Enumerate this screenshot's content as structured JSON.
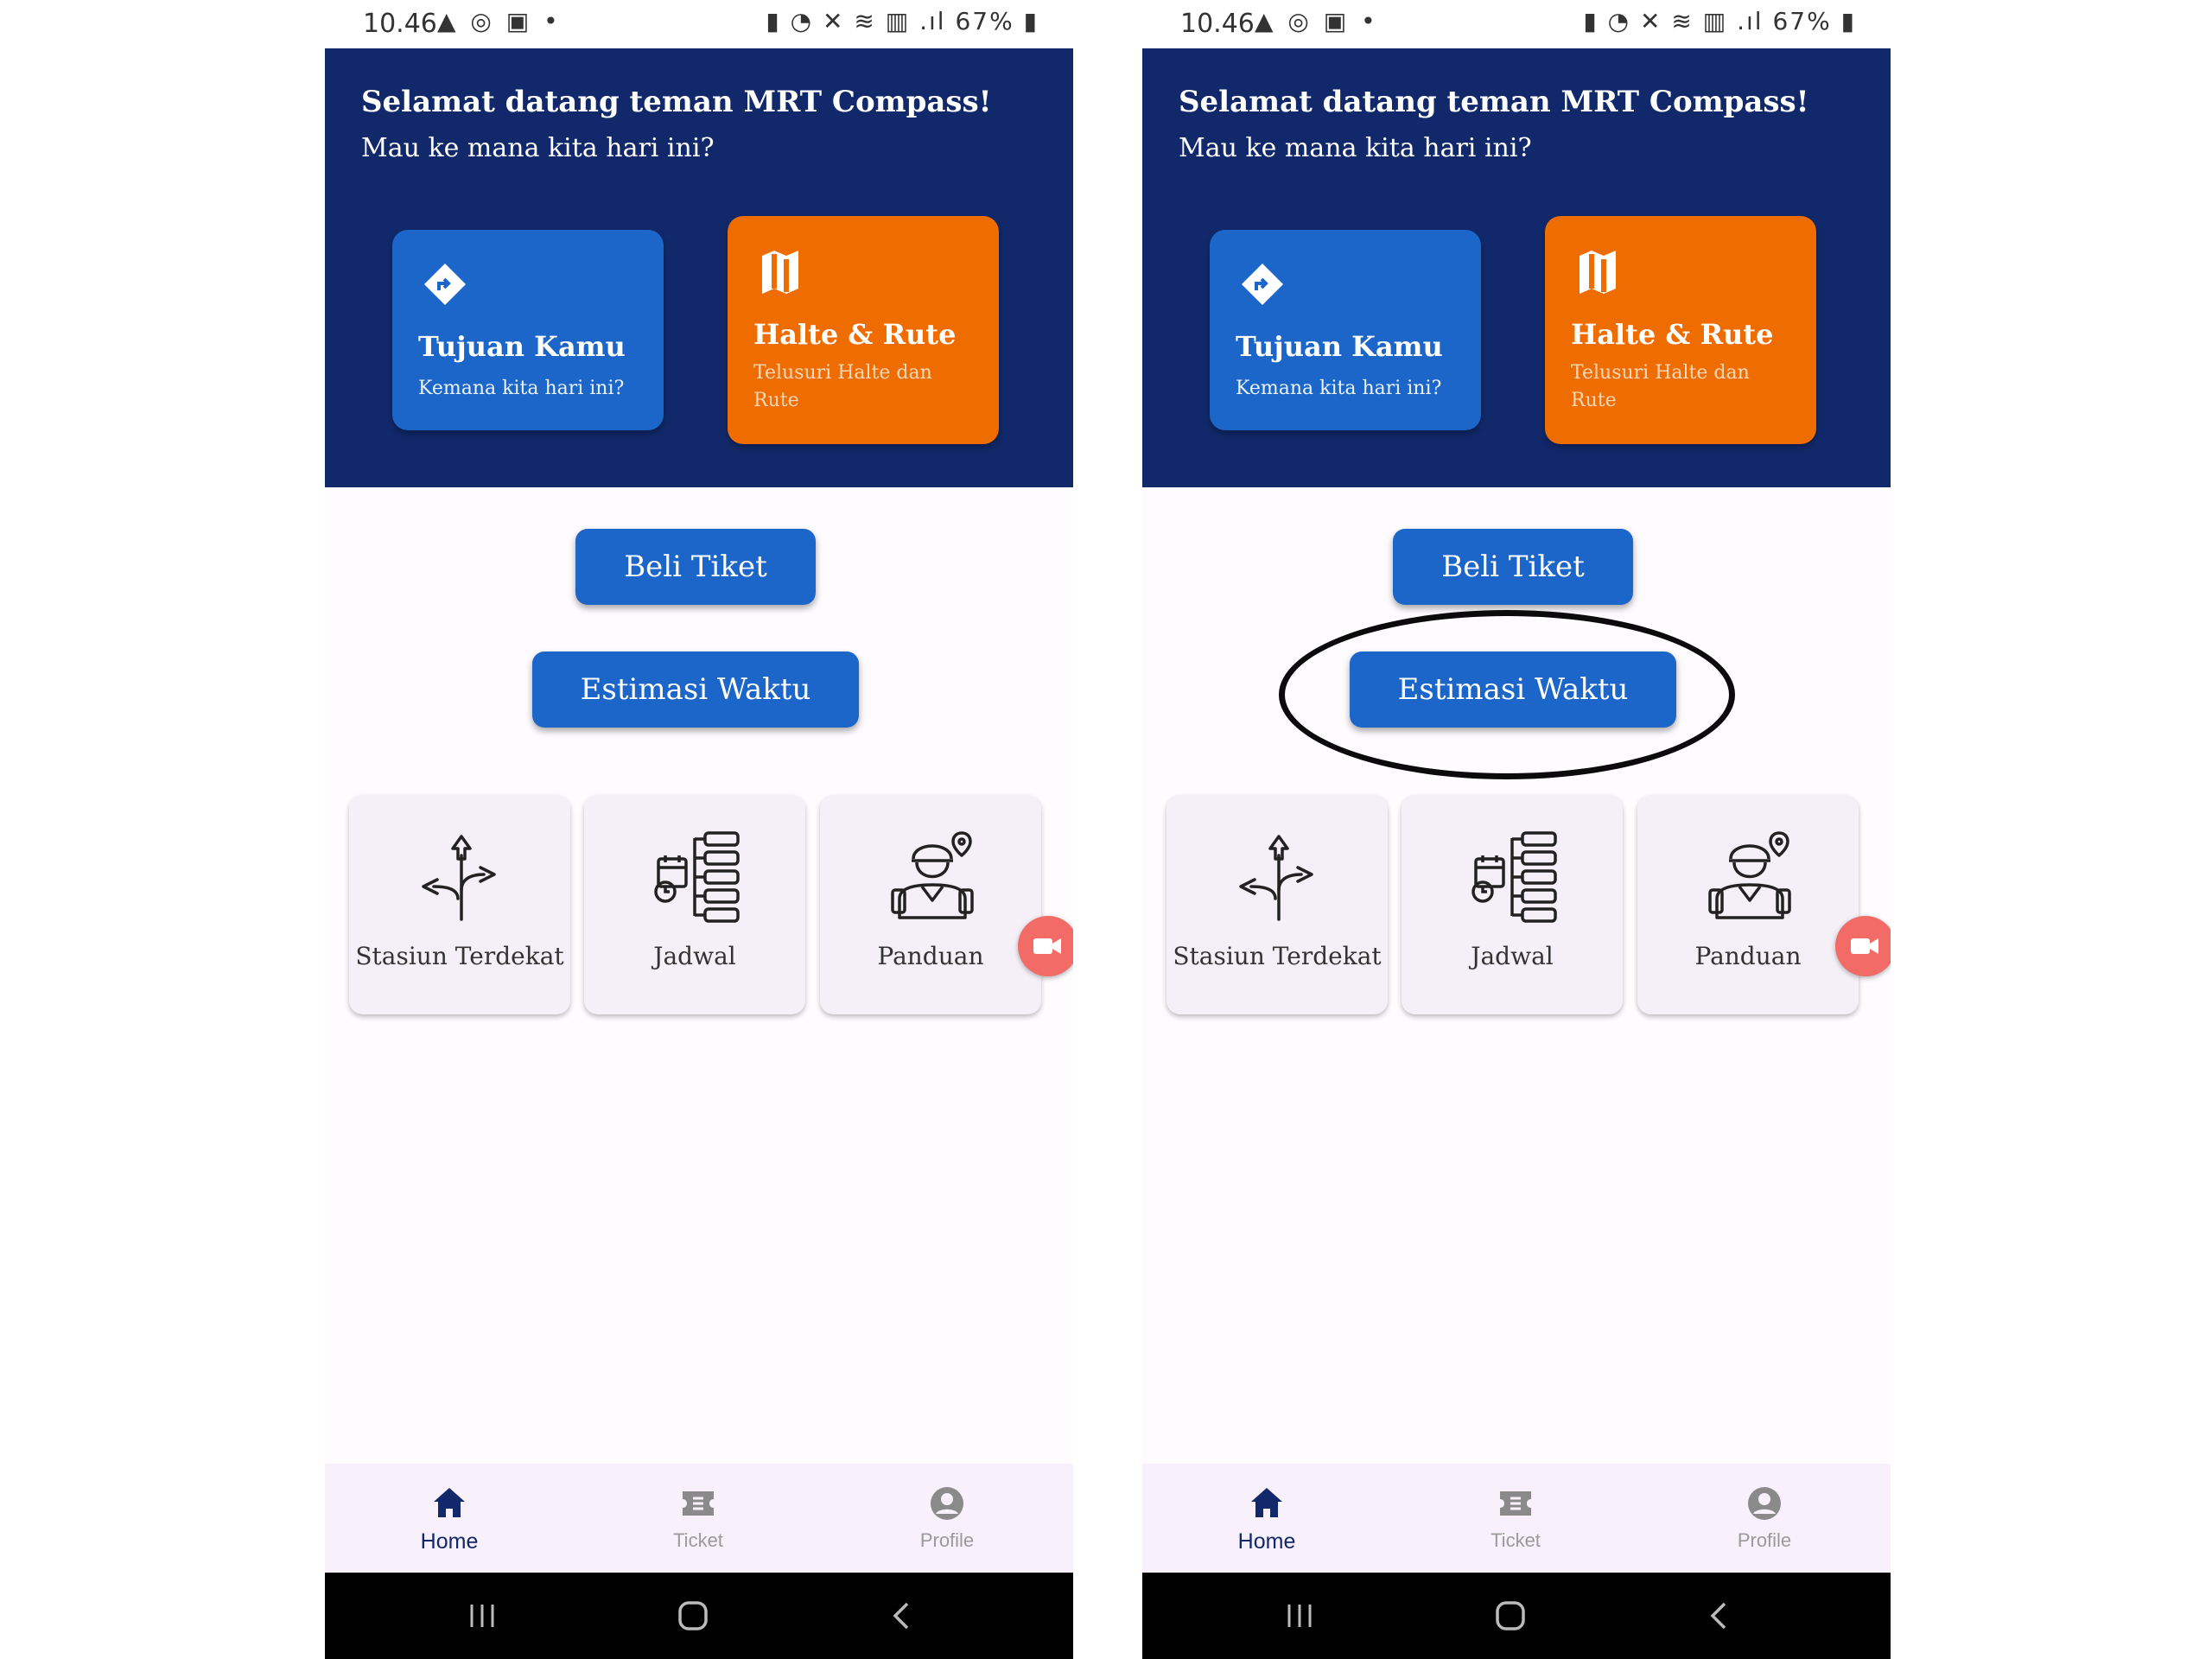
{
  "status_bar": {
    "time": "10.46",
    "battery": "67%"
  },
  "header": {
    "title": "Selamat datang teman MRT Compass!",
    "subtitle": "Mau ke mana kita hari ini?"
  },
  "cards": {
    "destination": {
      "title": "Tujuan Kamu",
      "subtitle": "Kemana kita hari ini?",
      "icon": "directions-icon",
      "color": "#1b66c8"
    },
    "routes": {
      "title": "Halte & Rute",
      "subtitle": "Telusuri Halte dan Rute",
      "icon": "map-icon",
      "color": "#ef6c00"
    }
  },
  "buttons": {
    "buy_ticket": "Beli Tiket",
    "estimate_time": "Estimasi Waktu"
  },
  "tiles": [
    {
      "label": "Stasiun Terdekat",
      "icon": "signpost-icon"
    },
    {
      "label": "Jadwal",
      "icon": "schedule-icon"
    },
    {
      "label": "Panduan",
      "icon": "guide-icon"
    }
  ],
  "bottom_nav": [
    {
      "label": "Home",
      "icon": "home-icon",
      "active": true
    },
    {
      "label": "Ticket",
      "icon": "ticket-icon",
      "active": false
    },
    {
      "label": "Profile",
      "icon": "profile-icon",
      "active": false
    }
  ],
  "colors": {
    "header_bg": "#11296b",
    "primary_blue": "#1b66c8",
    "orange": "#ef6c00",
    "fab": "#f26b66"
  }
}
